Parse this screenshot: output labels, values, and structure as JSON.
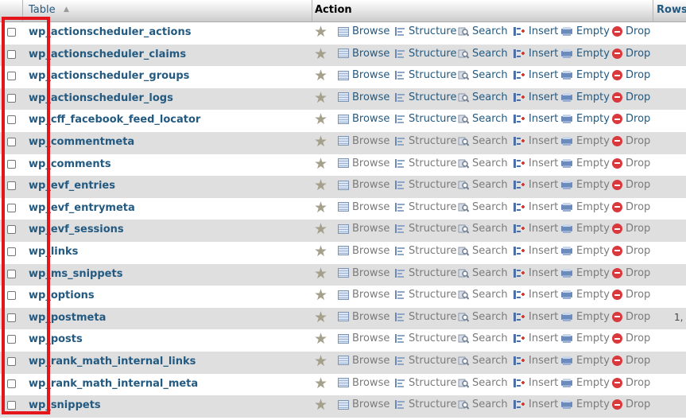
{
  "header": {
    "table_label": "Table",
    "sort_indicator": "▲",
    "action_label": "Action",
    "rows_label": "Rows"
  },
  "actions": {
    "browse": "Browse",
    "structure": "Structure",
    "search": "Search",
    "insert": "Insert",
    "empty": "Empty",
    "drop": "Drop"
  },
  "icons": {
    "favorite": "star-icon",
    "browse": "browse-icon",
    "structure": "structure-icon",
    "search": "search-icon",
    "insert": "insert-icon",
    "empty": "empty-icon",
    "drop": "drop-icon"
  },
  "tables": [
    {
      "name": "wp_actionscheduler_actions",
      "rows": ""
    },
    {
      "name": "wp_actionscheduler_claims",
      "rows": ""
    },
    {
      "name": "wp_actionscheduler_groups",
      "rows": ""
    },
    {
      "name": "wp_actionscheduler_logs",
      "rows": ""
    },
    {
      "name": "wp_cff_facebook_feed_locator",
      "rows": ""
    },
    {
      "name": "wp_commentmeta",
      "rows": ""
    },
    {
      "name": "wp_comments",
      "rows": ""
    },
    {
      "name": "wp_evf_entries",
      "rows": ""
    },
    {
      "name": "wp_evf_entrymeta",
      "rows": ""
    },
    {
      "name": "wp_evf_sessions",
      "rows": ""
    },
    {
      "name": "wp_links",
      "rows": ""
    },
    {
      "name": "wp_ms_snippets",
      "rows": ""
    },
    {
      "name": "wp_options",
      "rows": ""
    },
    {
      "name": "wp_postmeta",
      "rows": "1,"
    },
    {
      "name": "wp_posts",
      "rows": ""
    },
    {
      "name": "wp_rank_math_internal_links",
      "rows": ""
    },
    {
      "name": "wp_rank_math_internal_meta",
      "rows": ""
    },
    {
      "name": "wp_snippets",
      "rows": ""
    }
  ],
  "colors": {
    "link": "#235a81",
    "inactive": "#7b7b7b",
    "row_even": "#dfdfdf",
    "highlight_box": "#e4161b",
    "drop_icon": "#d9383c"
  }
}
